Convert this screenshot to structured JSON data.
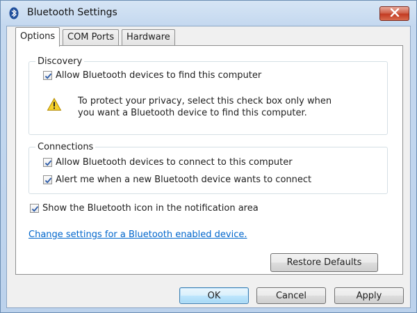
{
  "window": {
    "title": "Bluetooth Settings",
    "icon": "bluetooth-icon"
  },
  "tabs": [
    {
      "label": "Options",
      "active": true
    },
    {
      "label": "COM Ports",
      "active": false
    },
    {
      "label": "Hardware",
      "active": false
    }
  ],
  "discovery": {
    "label": "Discovery",
    "allow_find": {
      "label": "Allow Bluetooth devices to find this computer",
      "checked": true
    },
    "warning_icon": "warning-icon",
    "warning_line1": "To protect your privacy, select this check box only when",
    "warning_line2": "you want a Bluetooth device to find this computer."
  },
  "connections": {
    "label": "Connections",
    "allow_connect": {
      "label": "Allow Bluetooth devices to connect to this computer",
      "checked": true
    },
    "alert_new": {
      "label": "Alert me when a new Bluetooth device wants to connect",
      "checked": true
    }
  },
  "show_icon": {
    "label": "Show the Bluetooth icon in the notification area",
    "checked": true
  },
  "change_settings_link": "Change settings for a Bluetooth enabled device.",
  "buttons": {
    "restore_defaults": "Restore Defaults",
    "ok": "OK",
    "cancel": "Cancel",
    "apply": "Apply"
  },
  "colors": {
    "link": "#0066cc",
    "close_button": "#c33b22",
    "title_bar": "#c4d8ef"
  }
}
